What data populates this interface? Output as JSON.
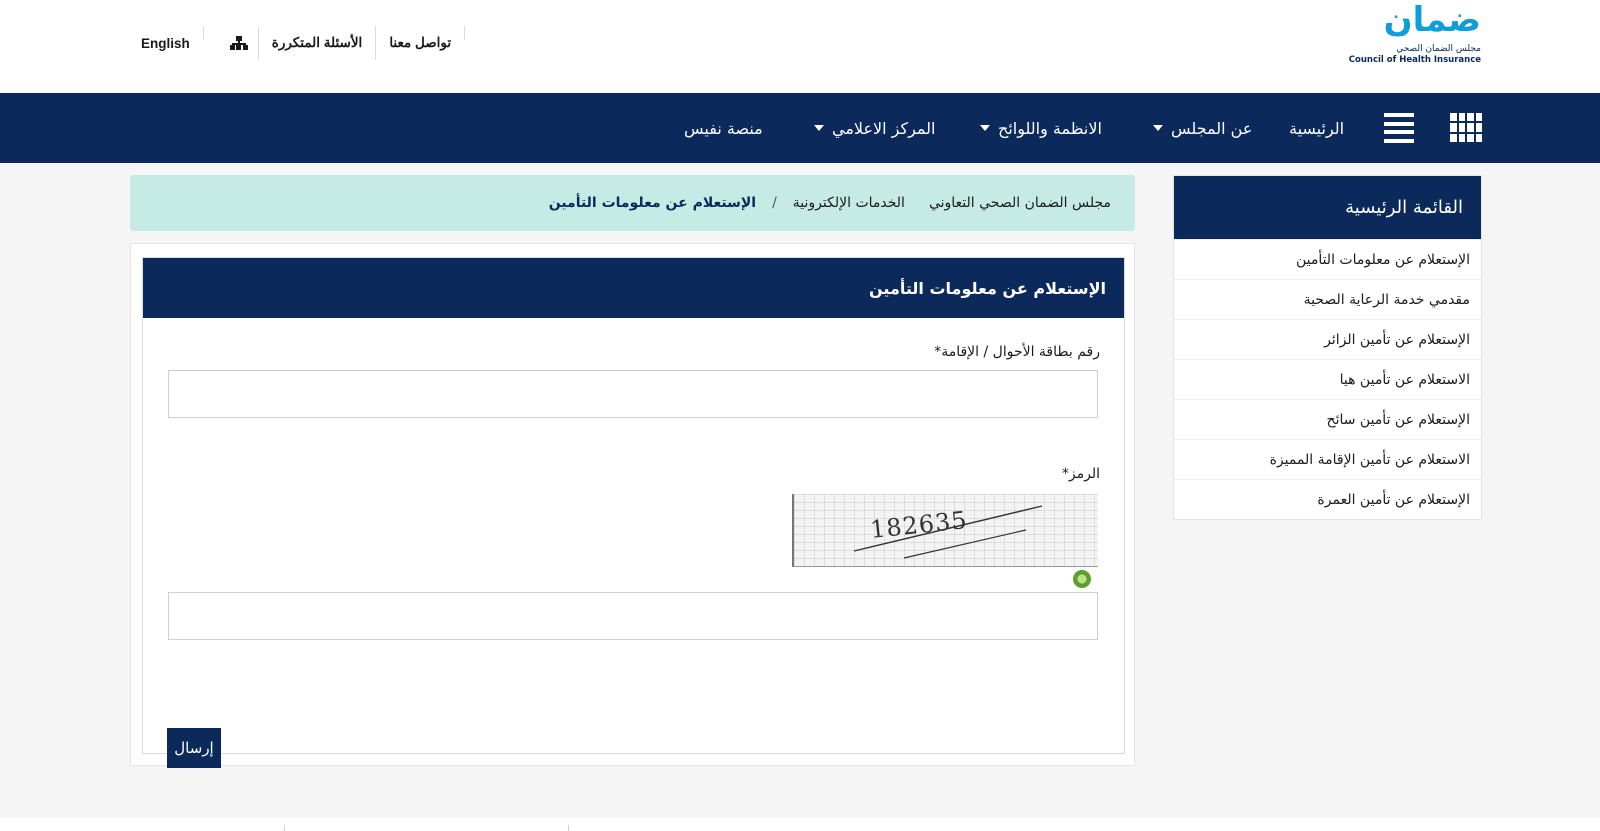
{
  "logo": {
    "wordmark": "ضمان",
    "line_ar": "مجلس الضمان الصحي",
    "line_en": "Council of Health Insurance"
  },
  "top_links": {
    "english": "English",
    "sitemap_icon": "sitemap-icon",
    "faq": "الأسئلة المتكررة",
    "contact": "تواصل معنا"
  },
  "nav": {
    "items": [
      {
        "label": "الرئيسية",
        "dropdown": false
      },
      {
        "label": "عن المجلس",
        "dropdown": true
      },
      {
        "label": "الانظمة واللوائح",
        "dropdown": true
      },
      {
        "label": "المركز الاعلامي",
        "dropdown": true
      },
      {
        "label": "منصة نفيس",
        "dropdown": false
      }
    ],
    "icons": [
      "apps-grid-icon",
      "menu-icon"
    ]
  },
  "sidebar": {
    "title": "القائمة الرئيسية",
    "items": [
      "الإستعلام عن معلومات التأمين",
      "مقدمي خدمة الرعاية الصحية",
      "الإستعلام عن تأمين الزائر",
      "الاستعلام عن تأمين هيا",
      "الإستعلام عن تأمين سائح",
      "الاستعلام عن تأمين الإقامة المميزة",
      "الإستعلام عن تأمين العمرة"
    ]
  },
  "breadcrumb": {
    "home": "مجلس الضمان الصحي التعاوني",
    "section": "الخدمات الإلكترونية",
    "separator": "/",
    "current": "الإستعلام عن معلومات التأمين"
  },
  "form": {
    "title": "الإستعلام عن معلومات التأمين",
    "id_label": "رقم بطاقة الأحوال / الإقامة*",
    "id_value": "",
    "code_label": "الرمز*",
    "captcha_text": "182635",
    "code_value": "",
    "submit_label": "إرسال"
  },
  "colors": {
    "navy": "#0b2a5b",
    "breadcrumb_bg": "#c6ebe4",
    "logo_blue": "#0f9ed8"
  }
}
